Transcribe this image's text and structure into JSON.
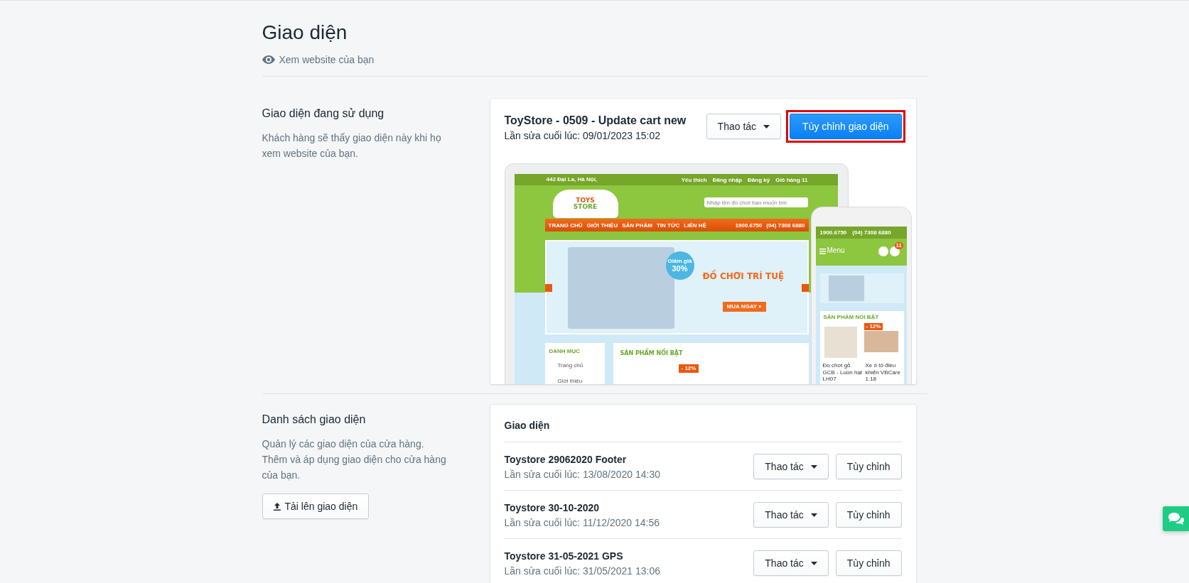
{
  "page": {
    "title": "Giao diện",
    "view_link": "Xem website của bạn"
  },
  "current_section": {
    "heading": "Giao diện đang sử dụng",
    "description": "Khách hàng sẽ thấy giao diện này khi họ xem website của bạn.",
    "theme": {
      "name": "ToyStore - 0509 - Update cart new",
      "last_edited": "Lần sửa cuối lúc: 09/01/2023 15:02"
    },
    "actions_button": "Thao tác",
    "customize_button": {
      "label": "Tùy chỉnh giao diện",
      "highlighted": true
    },
    "preview": {
      "location": "442 Đại La, Hà Nội,",
      "top_links": [
        "Yêu thích",
        "Đăng nhập",
        "Đăng ký",
        "Giỏ hàng 11"
      ],
      "logo": [
        "TOYS",
        "STORE"
      ],
      "search_placeholder": "Nhập tên đồ chơi bạn muốn tìm",
      "nav": [
        "TRANG CHỦ",
        "GIỚI THIỆU",
        "SẢN PHẨM",
        "TIN TỨC",
        "LIÊN HỆ"
      ],
      "phones": [
        "1900.6750",
        "(04) 7308 6880"
      ],
      "badge": [
        "Giảm giá",
        "30%"
      ],
      "banner_title": "ĐỒ CHƠI TRÍ TUỆ",
      "banner_button": "MUA NGAY »",
      "category_title": "DANH MỤC",
      "categories": [
        "Trang chủ",
        "Giới thiệu"
      ],
      "featured_title": "SẢN PHẨM NỔI BẬT",
      "discount": "- 12%",
      "mobile": {
        "phones": [
          "1900.6750",
          "(04) 7308 6880"
        ],
        "menu": "Menu",
        "cart_count": "11",
        "featured_title": "SẢN PHẨM NỔI BẬT",
        "discount": "- 12%",
        "products": [
          "Đồ chơi gỗ GCB - Luồn hạt LH07",
          "Xe ô tô điều khiển VBCare 1:18"
        ]
      }
    }
  },
  "themes_section": {
    "heading": "Danh sách giao diện",
    "description": [
      "Quản lý các giao diện của cửa hàng.",
      "Thêm và áp dụng giao diện cho cửa hàng của bạn."
    ],
    "upload_button": "Tải lên giao diện",
    "list_title": "Giao diện",
    "themes": [
      {
        "name": "Toystore 29062020 Footer",
        "last_edited": "Lần sửa cuối lúc: 13/08/2020 14:30",
        "actions_button": "Thao tác",
        "customize_button": "Tùy chỉnh"
      },
      {
        "name": "Toystore 30-10-2020",
        "last_edited": "Lần sửa cuối lúc: 11/12/2020 14:56",
        "actions_button": "Thao tác",
        "customize_button": "Tùy chỉnh"
      },
      {
        "name": "Toystore 31-05-2021 GPS",
        "last_edited": "Lần sửa cuối lúc: 31/05/2021 13:06",
        "actions_button": "Thao tác",
        "customize_button": "Tùy chỉnh"
      }
    ]
  }
}
